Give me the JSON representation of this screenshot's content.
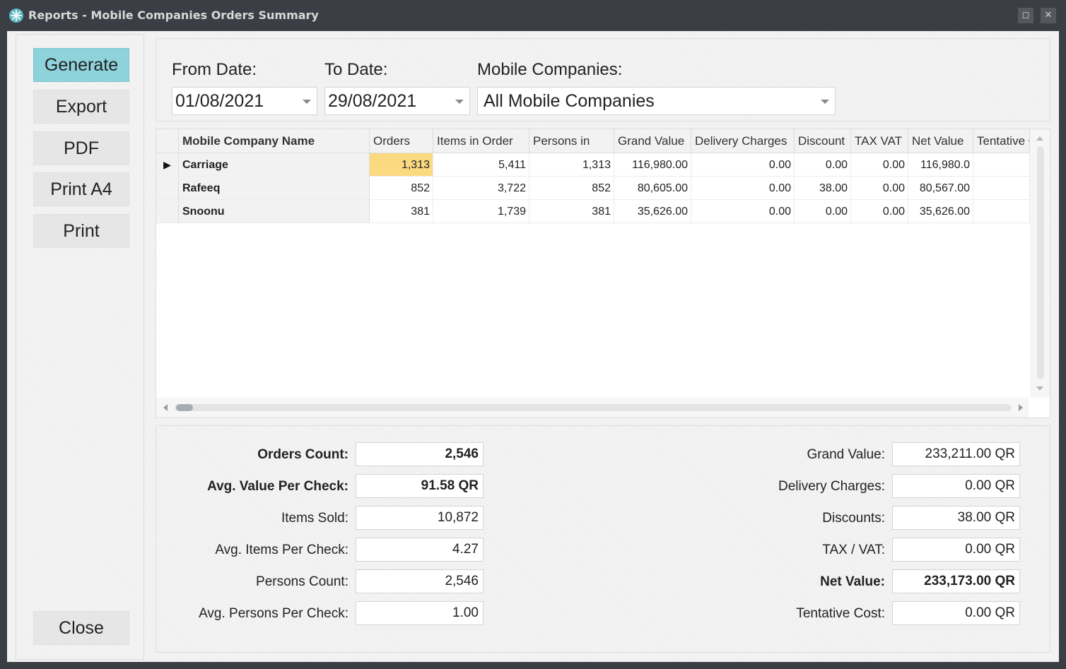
{
  "window": {
    "title": "Reports - Mobile Companies Orders Summary",
    "restore_glyph": "◻",
    "close_glyph": "✕"
  },
  "sidebar": {
    "buttons": [
      {
        "label": "Generate"
      },
      {
        "label": "Export"
      },
      {
        "label": "PDF"
      },
      {
        "label": "Print A4"
      },
      {
        "label": "Print"
      }
    ],
    "close_label": "Close",
    "active_color": "#8ed2dc"
  },
  "filters": {
    "from_date_label": "From Date:",
    "from_date_value": "01/08/2021",
    "to_date_label": "To Date:",
    "to_date_value": "29/08/2021",
    "companies_label": "Mobile Companies:",
    "companies_value": "All Mobile Companies"
  },
  "grid": {
    "columns": [
      "Mobile Company Name",
      "Orders",
      "Items in Order",
      "Persons in",
      "Grand Value",
      "Delivery Charges",
      "Discount",
      "TAX  VAT",
      "Net Value",
      "Tentative C"
    ],
    "rows": [
      [
        "Carriage",
        "1,313",
        "5,411",
        "1,313",
        "116,980.00",
        "0.00",
        "0.00",
        "0.00",
        "116,980.0",
        ""
      ],
      [
        "Rafeeq",
        "852",
        "3,722",
        "852",
        "80,605.00",
        "0.00",
        "38.00",
        "0.00",
        "80,567.00",
        ""
      ],
      [
        "Snoonu",
        "381",
        "1,739",
        "381",
        "35,626.00",
        "0.00",
        "0.00",
        "0.00",
        "35,626.00",
        ""
      ]
    ],
    "row_indicator": "▶",
    "selected_cell_color": "#fbd981"
  },
  "summary": {
    "left": [
      {
        "label": "Orders Count:",
        "value": "2,546",
        "bold": true
      },
      {
        "label": "Avg. Value Per Check:",
        "value": "91.58 QR",
        "bold": true
      },
      {
        "label": "Items Sold:",
        "value": "10,872",
        "bold": false
      },
      {
        "label": "Avg. Items Per Check:",
        "value": "4.27",
        "bold": false
      },
      {
        "label": "Persons Count:",
        "value": "2,546",
        "bold": false
      },
      {
        "label": "Avg. Persons Per Check:",
        "value": "1.00",
        "bold": false
      }
    ],
    "right": [
      {
        "label": "Grand Value:",
        "value": "233,211.00 QR",
        "bold": false
      },
      {
        "label": "Delivery Charges:",
        "value": "0.00 QR",
        "bold": false
      },
      {
        "label": "Discounts:",
        "value": "38.00 QR",
        "bold": false
      },
      {
        "label": "TAX / VAT:",
        "value": "0.00 QR",
        "bold": false
      },
      {
        "label": "Net Value:",
        "value": "233,173.00 QR",
        "bold": true
      },
      {
        "label": "Tentative Cost:",
        "value": "0.00 QR",
        "bold": false
      }
    ]
  }
}
